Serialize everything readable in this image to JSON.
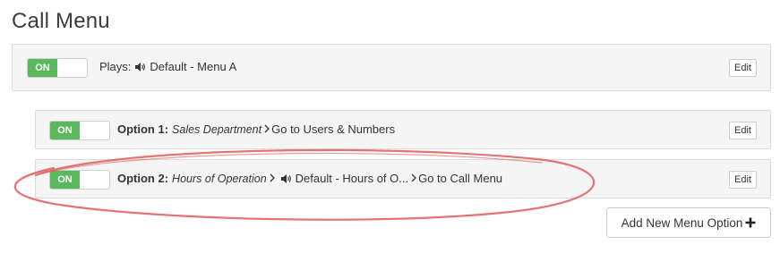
{
  "page": {
    "title": "Call Menu"
  },
  "main_row": {
    "toggle_label": "ON",
    "plays_label": "Plays:",
    "audio_name": "Default - Menu A",
    "edit_label": "Edit"
  },
  "options": [
    {
      "toggle_label": "ON",
      "option_label": "Option 1:",
      "option_name": "Sales Department",
      "action": "Go to Users & Numbers",
      "edit_label": "Edit"
    },
    {
      "toggle_label": "ON",
      "option_label": "Option 2:",
      "option_name": "Hours of Operation",
      "audio_name": "Default - Hours of O...",
      "action": "Go to Call Menu",
      "edit_label": "Edit"
    }
  ],
  "add_button": {
    "label": "Add New Menu Option"
  },
  "colors": {
    "toggle_on": "#5cb85c",
    "panel_bg": "#f5f5f5",
    "annotation_stroke": "#e05a5a"
  },
  "icons": {
    "speaker": "speaker-icon",
    "chevron": "chevron-right-icon",
    "plus": "plus-icon"
  }
}
